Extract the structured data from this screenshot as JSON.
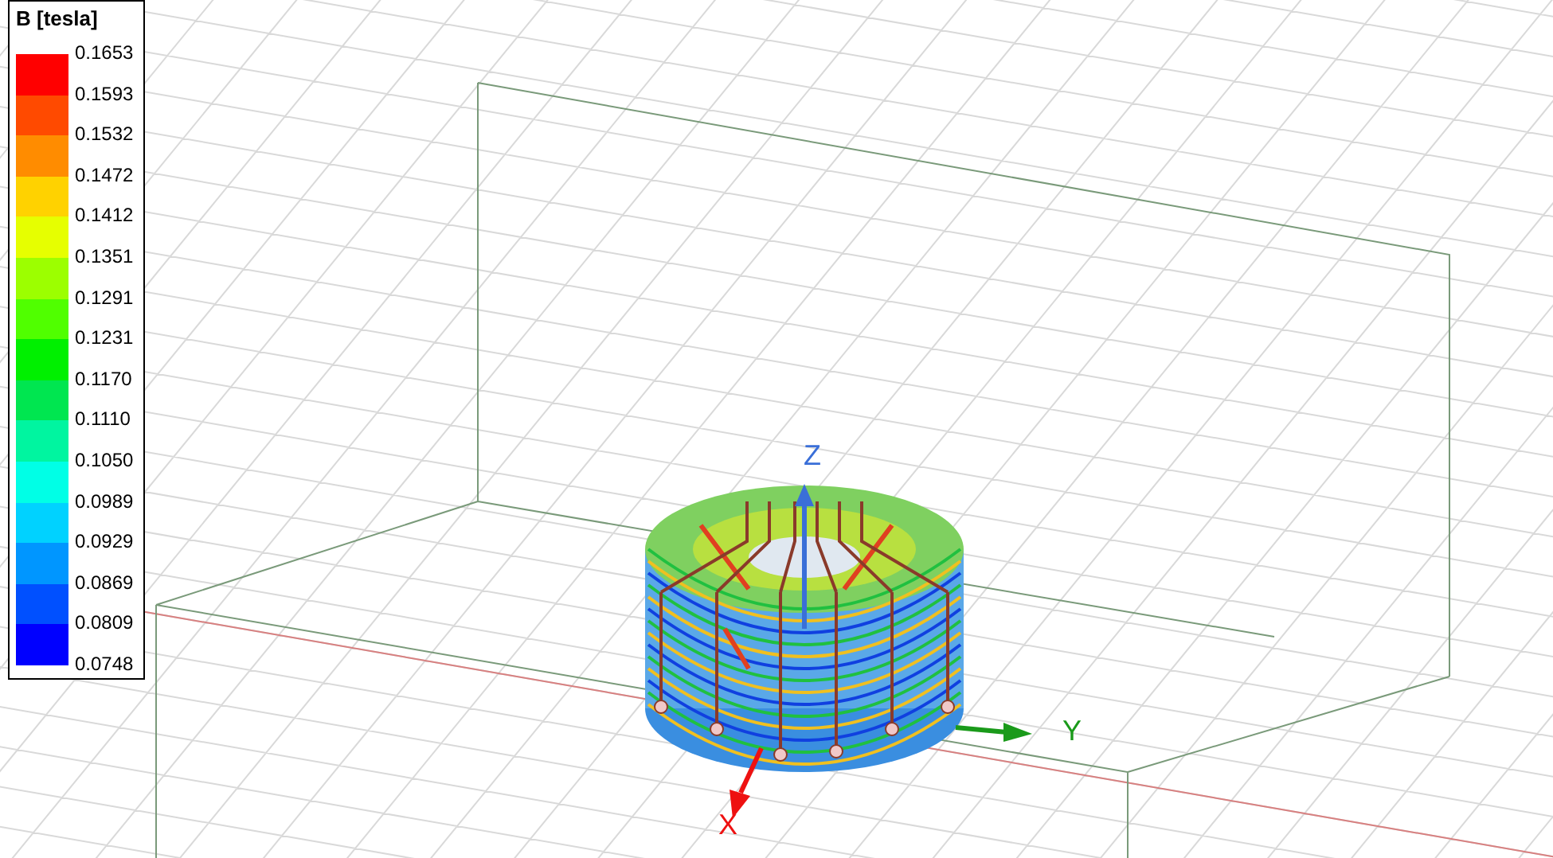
{
  "legend": {
    "title": "B [tesla]",
    "values": [
      "0.1653",
      "0.1593",
      "0.1532",
      "0.1472",
      "0.1412",
      "0.1351",
      "0.1291",
      "0.1231",
      "0.1170",
      "0.1110",
      "0.1050",
      "0.0989",
      "0.0929",
      "0.0869",
      "0.0809",
      "0.0748"
    ],
    "bands": [
      {
        "color": "#ff0000"
      },
      {
        "color": "#ff4a00"
      },
      {
        "color": "#ff8c00"
      },
      {
        "color": "#ffd200"
      },
      {
        "color": "#e6ff00"
      },
      {
        "color": "#9cff00"
      },
      {
        "color": "#50ff00"
      },
      {
        "color": "#00f000"
      },
      {
        "color": "#00e650"
      },
      {
        "color": "#00f5a0"
      },
      {
        "color": "#00ffe6"
      },
      {
        "color": "#00d2ff"
      },
      {
        "color": "#0096ff"
      },
      {
        "color": "#0050ff"
      },
      {
        "color": "#0000ff"
      }
    ]
  },
  "axes": [
    {
      "kind": "z",
      "label": "Z",
      "color": "#3a6fd8"
    },
    {
      "kind": "y",
      "label": "Y",
      "color": "#1a9a1a"
    },
    {
      "kind": "x",
      "label": "X",
      "color": "#ee1111"
    }
  ]
}
